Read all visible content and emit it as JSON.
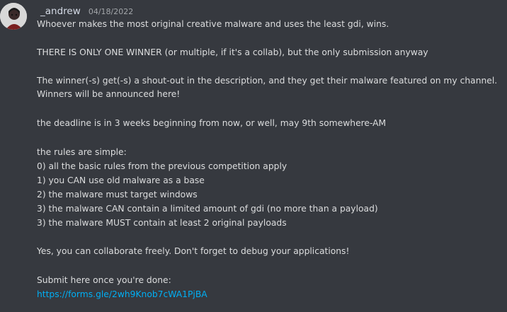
{
  "message": {
    "author": "_andrew",
    "timestamp": "04/18/2022",
    "avatar_icon": "user-avatar",
    "lines": [
      "Whoever makes the most original creative malware and uses the least gdi, wins.",
      "THERE IS ONLY ONE WINNER (or multiple, if it's a collab), but the only submission anyway",
      "The winner(-s) get(-s) a shout-out in the description, and they get their malware featured on my channel.",
      "Winners will be announced here!",
      "the deadline is in 3 weeks beginning from now, or well, may 9th somewhere-AM",
      "the rules are simple:",
      "0) all the basic rules from the previous competition apply",
      "1) you CAN use old malware as a base",
      "2) the malware must target windows",
      "3) the malware CAN contain a limited amount of gdi (no more than a payload)",
      "3) the malware MUST contain at least 2 original payloads",
      "Yes, you can collaborate freely. Don't forget to debug your applications!",
      "Submit here once you're done:"
    ],
    "link": "https://forms.gle/2wh9Knob7cWA1PjBA"
  },
  "colors": {
    "background": "#36393f",
    "text": "#dcddde",
    "username": "#d5dbe6",
    "timestamp": "#a3a6aa",
    "link": "#00aff4"
  }
}
